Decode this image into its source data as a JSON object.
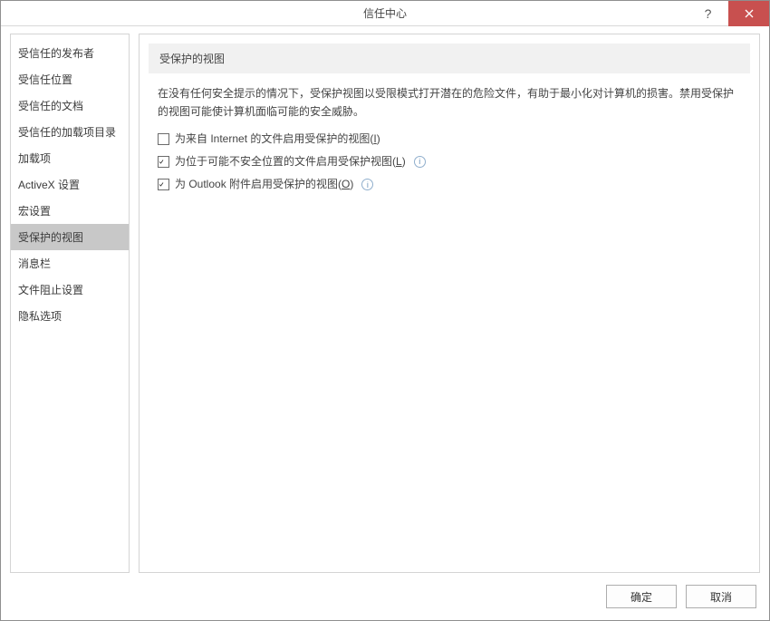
{
  "titlebar": {
    "title": "信任中心",
    "help": "?",
    "close": "×"
  },
  "sidebar": {
    "items": [
      {
        "label": "受信任的发布者",
        "selected": false
      },
      {
        "label": "受信任位置",
        "selected": false
      },
      {
        "label": "受信任的文档",
        "selected": false
      },
      {
        "label": "受信任的加载项目录",
        "selected": false
      },
      {
        "label": "加载项",
        "selected": false
      },
      {
        "label": "ActiveX 设置",
        "selected": false
      },
      {
        "label": "宏设置",
        "selected": false
      },
      {
        "label": "受保护的视图",
        "selected": true
      },
      {
        "label": "消息栏",
        "selected": false
      },
      {
        "label": "文件阻止设置",
        "selected": false
      },
      {
        "label": "隐私选项",
        "selected": false
      }
    ]
  },
  "content": {
    "section_title": "受保护的视图",
    "description": "在没有任何安全提示的情况下，受保护视图以受限模式打开潜在的危险文件，有助于最小化对计算机的损害。禁用受保护的视图可能使计算机面临可能的安全威胁。",
    "checks": [
      {
        "label_pre": "为来自 Internet 的文件启用受保护的视图(",
        "accel": "I",
        "label_post": ")",
        "checked": false,
        "info": false
      },
      {
        "label_pre": "为位于可能不安全位置的文件启用受保护视图(",
        "accel": "L",
        "label_post": ")",
        "checked": true,
        "info": true
      },
      {
        "label_pre": "为 Outlook 附件启用受保护的视图(",
        "accel": "O",
        "label_post": ")",
        "checked": true,
        "info": true
      }
    ]
  },
  "footer": {
    "ok": "确定",
    "cancel": "取消"
  }
}
